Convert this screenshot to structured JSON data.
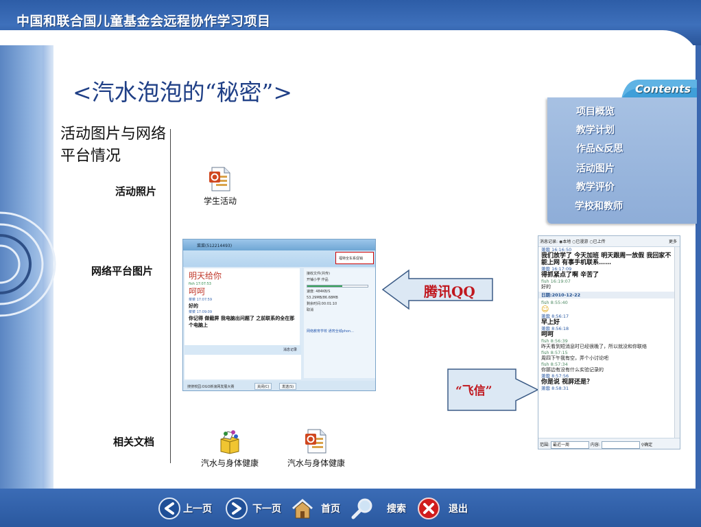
{
  "banner": {
    "title": "中国和联合国儿童基金会远程协作学习项目"
  },
  "slide": {
    "title": "<汽水泡泡的“秘密”>",
    "section_heading": "活动图片与网络平台情况",
    "labels": {
      "photos": "活动照片",
      "network": "网络平台图片",
      "docs": "相关文档"
    }
  },
  "files": {
    "student_activity": "学生活动",
    "doc1": "汽水与身体健康",
    "doc2": "汽水与身体健康"
  },
  "callouts": {
    "qq": "腾讯QQ",
    "fetion": "“飞信”"
  },
  "qq_window": {
    "title": "菜菜(512214493)",
    "ad": "福特全车系促销",
    "messages": [
      {
        "type": "big",
        "text": "明天给你"
      },
      {
        "type": "meta_green",
        "text": "fish 17:07:53"
      },
      {
        "type": "big",
        "text": "呵呵"
      },
      {
        "type": "meta_blue",
        "text": "菜菜 17:07:59"
      },
      {
        "type": "text",
        "text": "好的"
      },
      {
        "type": "meta_blue",
        "text": "菜菜 17:09:09"
      },
      {
        "type": "text",
        "text": "你记得 做截屏 我电脑出问题了 之前联系的全在那个电脑上"
      }
    ],
    "file_panel": {
      "heading": "接收文件(共传)",
      "file": "开铺小学 作品",
      "speed": "速度: 484KB/S",
      "size": "53.29MB/86.68MB",
      "remaining": "剩余时间:00:01:10",
      "cancel": "取消",
      "progress": 0.58,
      "link": "网络教育学校 通宵全城phon..."
    },
    "input_toolbar": "消息记录",
    "status": "搜搜校园:OGO新浪网发展大赛",
    "close_btn": "关闭(C)",
    "send_btn": "发送(S)"
  },
  "fetion_window": {
    "topbar": {
      "label": "消息记录:",
      "opt_local": "本地",
      "opt_roam": "已漫游",
      "opt_upload": "已上传",
      "more": "更多"
    },
    "messages": [
      {
        "type": "meta_blue",
        "text": "萧蓉 16:16:50"
      },
      {
        "type": "bold",
        "text": "我们放学了 今天加班 明天跟周一放假 我回家不能上网 有事手机联系……"
      },
      {
        "type": "meta_blue",
        "text": "萧蓉 16:17:09"
      },
      {
        "type": "bold",
        "text": "得抓紧点了啊 辛苦了"
      },
      {
        "type": "meta_green",
        "text": "fish 16:19:07"
      },
      {
        "type": "msg",
        "text": "好的"
      },
      {
        "type": "date",
        "text": "日期:2010-12-22"
      },
      {
        "type": "meta_green",
        "text": "fish 8:55:40"
      },
      {
        "type": "emoji",
        "text": "☺"
      },
      {
        "type": "meta_blue",
        "text": "萧蓉 8:56:17"
      },
      {
        "type": "bold",
        "text": "早上好"
      },
      {
        "type": "meta_blue",
        "text": "萧蓉 8:56:18"
      },
      {
        "type": "bold",
        "text": "呵呵"
      },
      {
        "type": "meta_green",
        "text": "fish 8:56:39"
      },
      {
        "type": "msg",
        "text": "昨天看到短消息时已经很晚了，所以就没和你联络"
      },
      {
        "type": "meta_green",
        "text": "fish 8:57:15"
      },
      {
        "type": "msg",
        "text": "周四下午我有空，弄个小讨论吧"
      },
      {
        "type": "meta_green",
        "text": "fish 8:57:34"
      },
      {
        "type": "msg",
        "text": "你那边有没有什么实验记录的"
      },
      {
        "type": "meta_blue",
        "text": "萧蓉 8:57:56"
      },
      {
        "type": "bold",
        "text": "你是说 视屏还是？"
      },
      {
        "type": "meta_blue",
        "text": "萧蓉 8:58:31"
      }
    ],
    "bottom": {
      "range_label": "范围:",
      "range_value": "最近一周",
      "content_label": "内容:",
      "ok": "确定"
    }
  },
  "contents": {
    "label": "Contents",
    "items": [
      "项目概览",
      "教学计划",
      "作品&反思",
      "活动图片",
      "教学评价",
      "学校和教师"
    ]
  },
  "nav": {
    "prev": "上一页",
    "next": "下一页",
    "home": "首页",
    "search": "搜索",
    "exit": "退出"
  },
  "colors": {
    "banner_blue": "#2d5da7",
    "title_blue": "#1f3f86",
    "callout_red": "#c0171e",
    "contents_panel": "#9ab6dd"
  }
}
